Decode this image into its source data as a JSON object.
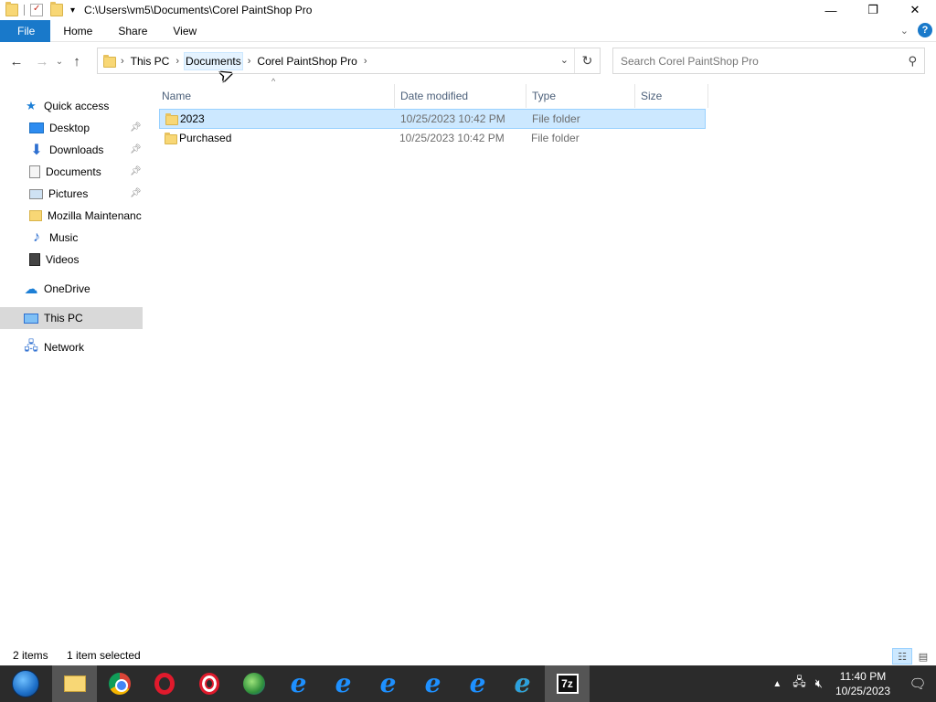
{
  "window": {
    "title": "C:\\Users\\vm5\\Documents\\Corel PaintShop Pro",
    "controls": {
      "minimize": "—",
      "restore": "❐",
      "close": "✕"
    }
  },
  "ribbon": {
    "tabs": [
      "File",
      "Home",
      "Share",
      "View"
    ],
    "help": "?"
  },
  "nav": {
    "back": "←",
    "forward": "→",
    "recent": "⌄",
    "up": "↑",
    "breadcrumb": [
      "This PC",
      "Documents",
      "Corel PaintShop Pro"
    ],
    "refresh": "↻"
  },
  "search": {
    "placeholder": "Search Corel PaintShop Pro"
  },
  "sidebar": {
    "items": [
      {
        "label": "Quick access",
        "icon": "star-icon",
        "level": 0
      },
      {
        "label": "Desktop",
        "icon": "desktop-icon",
        "level": 1,
        "pinned": true
      },
      {
        "label": "Downloads",
        "icon": "downloads-icon",
        "level": 1,
        "pinned": true
      },
      {
        "label": "Documents",
        "icon": "documents-icon",
        "level": 1,
        "pinned": true
      },
      {
        "label": "Pictures",
        "icon": "pictures-icon",
        "level": 1,
        "pinned": true
      },
      {
        "label": "Mozilla Maintenanc",
        "icon": "folder-icon",
        "level": 1
      },
      {
        "label": "Music",
        "icon": "music-icon",
        "level": 1
      },
      {
        "label": "Videos",
        "icon": "videos-icon",
        "level": 1
      },
      {
        "label": "OneDrive",
        "icon": "cloud-icon",
        "level": 0
      },
      {
        "label": "This PC",
        "icon": "computer-icon",
        "level": 0,
        "selected": true
      },
      {
        "label": "Network",
        "icon": "network-icon",
        "level": 0
      }
    ]
  },
  "columns": [
    "Name",
    "Date modified",
    "Type",
    "Size"
  ],
  "files": [
    {
      "name": "2023",
      "modified": "10/25/2023 10:42 PM",
      "type": "File folder",
      "size": "",
      "selected": true
    },
    {
      "name": "Purchased",
      "modified": "10/25/2023 10:42 PM",
      "type": "File folder",
      "size": "",
      "selected": false
    }
  ],
  "status": {
    "count": "2 items",
    "selection": "1 item selected"
  },
  "taskbar": {
    "apps": [
      "start-icon",
      "file-explorer-icon",
      "chrome-icon",
      "opera-icon",
      "opera-gx-icon",
      "globe-icon",
      "ie-icon",
      "ie-icon",
      "ie-icon",
      "ie-icon",
      "ie-icon",
      "ie-icon",
      "7zip-icon"
    ],
    "time": "11:40 PM",
    "date": "10/25/2023"
  },
  "colors": {
    "accent": "#1979ca",
    "selection": "#cce8ff",
    "selection_border": "#99d1ff",
    "taskbar": "#2b2b2b"
  }
}
